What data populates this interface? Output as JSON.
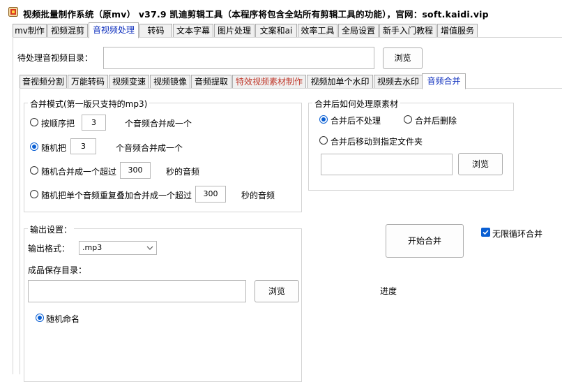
{
  "window": {
    "title": "视频批量制作系统（原mv） v37.9      凯迪剪辑工具（本程序将包含全站所有剪辑工具的功能），官网：soft.kaidi.vip"
  },
  "main_tabs": [
    {
      "label": "mv制作"
    },
    {
      "label": "视频混剪"
    },
    {
      "label": "音视频处理"
    },
    {
      "label": "转码"
    },
    {
      "label": "文本字幕"
    },
    {
      "label": "图片处理"
    },
    {
      "label": "文案和ai"
    },
    {
      "label": "效率工具"
    },
    {
      "label": "全局设置"
    },
    {
      "label": "新手入门教程"
    },
    {
      "label": "增值服务"
    }
  ],
  "source_dir": {
    "label": "待处理音视频目录：",
    "value": "",
    "browse": "浏览"
  },
  "sub_tabs": [
    {
      "label": "音视频分割"
    },
    {
      "label": "万能转码"
    },
    {
      "label": "视频变速"
    },
    {
      "label": "视频镜像"
    },
    {
      "label": "音频提取"
    },
    {
      "label": "特效视频素材制作"
    },
    {
      "label": "视频加单个水印"
    },
    {
      "label": "视频去水印"
    },
    {
      "label": "音频合并"
    }
  ],
  "merge_mode": {
    "title": "合并模式(第一版只支持的mp3)",
    "opt1_label": "按顺序把",
    "opt1_value": "3",
    "opt1_suffix": "个音频合并成一个",
    "opt2_label": "随机把",
    "opt2_value": "3",
    "opt2_suffix": "个音频合并成一个",
    "opt3_label": "随机合并成一个超过",
    "opt3_value": "300",
    "opt3_suffix": "秒的音频",
    "opt4_label": "随机把单个音频重复叠加合并成一个超过",
    "opt4_value": "300",
    "opt4_suffix": "秒的音频"
  },
  "after_merge": {
    "title": "合并后如何处理原素材",
    "opt_keep": "合并后不处理",
    "opt_delete": "合并后删除",
    "opt_move": "合并后移动到指定文件夹",
    "folder_value": "",
    "browse": "浏览"
  },
  "output": {
    "title": "输出设置：",
    "format_label": "输出格式：",
    "format_value": ".mp3",
    "save_dir_label": "成品保存目录：",
    "save_dir_value": "",
    "browse": "浏览",
    "random_name": "随机命名"
  },
  "actions": {
    "start": "开始合并",
    "loop_label": "无限循环合并",
    "progress_label": "进度"
  },
  "colors": {
    "accent": "#0a5fd3",
    "highlight_tab": "#c0392b"
  }
}
